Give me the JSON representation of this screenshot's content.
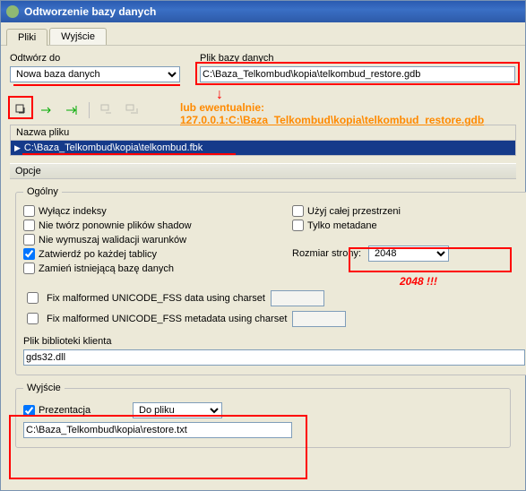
{
  "window": {
    "title": "Odtworzenie bazy danych"
  },
  "tabs": {
    "pliki": "Pliki",
    "wyjscie": "Wyjście"
  },
  "fields": {
    "restoreToLabel": "Odtwórz do",
    "restoreToValue": "Nowa baza danych",
    "dbFileLabel": "Plik bazy danych",
    "dbFileValue": "C:\\Baza_Telkombud\\kopia\\telkombud_restore.gdb"
  },
  "annotation": {
    "line1": "lub ewentualnie:",
    "line2": "127.0.0.1:C:\\Baza_Telkombud\\kopia\\telkombud_restore.gdb"
  },
  "arrow": "↓",
  "filelist": {
    "header": "Nazwa pliku",
    "row": "C:\\Baza_Telkombud\\kopia\\telkombud.fbk"
  },
  "options": {
    "header": "Opcje",
    "generalLegend": "Ogólny",
    "left": {
      "deactivateIdx": "Wyłącz indeksy",
      "noShadow": "Nie twórz ponownie plików shadow",
      "noValidity": "Nie wymuszaj walidacji warunków",
      "commitEach": "Zatwierdź po każdej tablicy",
      "replace": "Zamień istniejącą bazę danych"
    },
    "right": {
      "useAll": "Użyj całej przestrzeni",
      "metaOnly": "Tylko metadane",
      "pageSizeLabel": "Rozmiar strony:",
      "pageSizeValue": "2048"
    },
    "pageSizeNote": "2048 !!!",
    "fixData": "Fix malformed UNICODE_FSS data using charset",
    "fixMeta": "Fix malformed UNICODE_FSS metadata using charset",
    "clientLibLabel": "Plik biblioteki klienta",
    "clientLibValue": "gds32.dll"
  },
  "output": {
    "legend": "Wyjście",
    "verbose": "Prezentacja",
    "target": "Do pliku",
    "path": "C:\\Baza_Telkombud\\kopia\\restore.txt"
  }
}
